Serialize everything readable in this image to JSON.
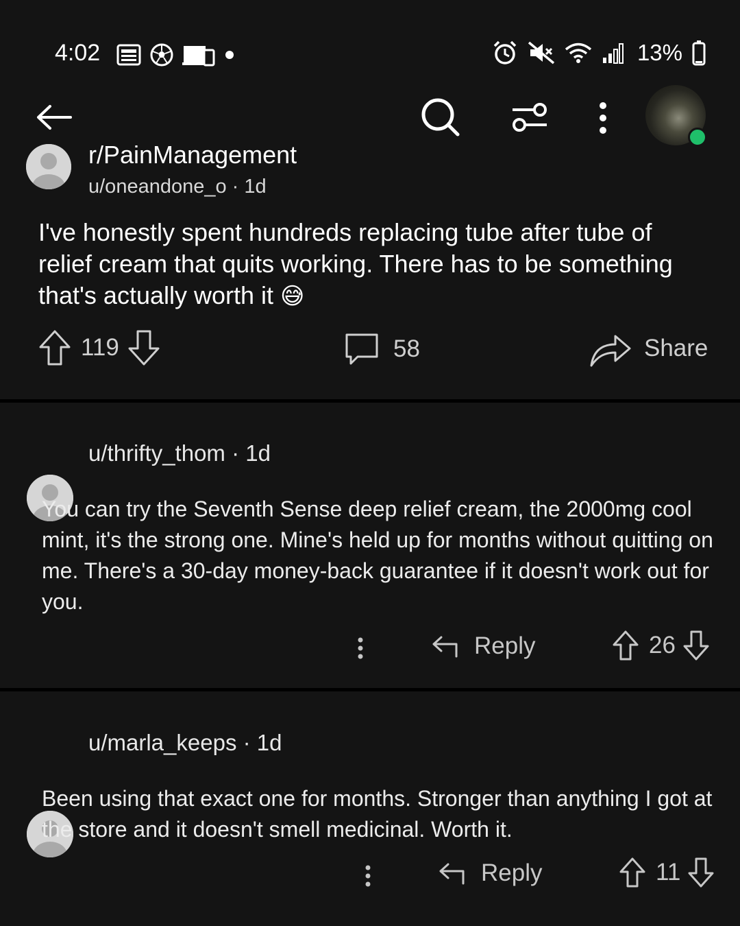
{
  "status_bar": {
    "time": "4:02",
    "battery": "13%"
  },
  "post": {
    "subreddit": "r/PainManagement",
    "author_line": "u/oneandone_o · 1d",
    "body": "I've honestly spent hundreds replacing tube after tube of relief cream that quits working. There has to be something that's actually worth it",
    "emoji": "😅",
    "upvotes": "119",
    "comments": "58",
    "share_label": "Share"
  },
  "comments": [
    {
      "author_line": "u/thrifty_thom · 1d",
      "body": "You can try the Seventh Sense deep relief cream, the 2000mg cool mint, it's the strong one. Mine's held up for months without quitting on me. There's a 30-day money-back guarantee if it doesn't work out for you.",
      "reply_label": "Reply",
      "votes": "26"
    },
    {
      "author_line": "u/marla_keeps · 1d",
      "body": "Been using that exact one for months. Stronger than anything I got at the store and it doesn't smell medicinal. Worth it.",
      "reply_label": "Reply",
      "votes": "11"
    }
  ],
  "colors": {
    "background": "#141414",
    "divider": "#000000",
    "online_dot": "#1fbf6a"
  }
}
